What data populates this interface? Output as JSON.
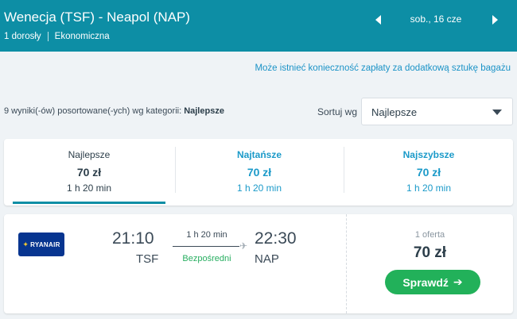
{
  "header": {
    "route": "Wenecja (TSF) - Neapol (NAP)",
    "passengers": "1 dorosły",
    "cabin": "Ekonomiczna",
    "date": "sob., 16 cze",
    "prev_icon": "chevron-left-icon",
    "next_icon": "chevron-right-icon",
    "background_color": "#0d8ea5"
  },
  "bag_notice": "Może istnieć konieczność zapłaty za dodatkową sztukę bagażu",
  "results": {
    "summary_prefix": "9 wyniki(-ów) posortowane(-ych) wg kategorii: ",
    "summary_category": "Najlepsze"
  },
  "sort": {
    "label": "Sortuj wg",
    "selected": "Najlepsze"
  },
  "tabs": [
    {
      "label": "Najlepsze",
      "price": "70 zł",
      "duration": "1 h 20 min",
      "active": true
    },
    {
      "label": "Najtańsze",
      "price": "70 zł",
      "duration": "1 h 20 min",
      "active": false
    },
    {
      "label": "Najszybsze",
      "price": "70 zł",
      "duration": "1 h 20 min",
      "active": false
    }
  ],
  "flight": {
    "airline": "RYANAIR",
    "departure_time": "21:10",
    "departure_code": "TSF",
    "duration": "1 h 20 min",
    "stops": "Bezpośredni",
    "arrival_time": "22:30",
    "arrival_code": "NAP",
    "offers": "1 oferta",
    "price": "70 zł",
    "cta": "Sprawdź",
    "cta_color": "#22b15a"
  }
}
